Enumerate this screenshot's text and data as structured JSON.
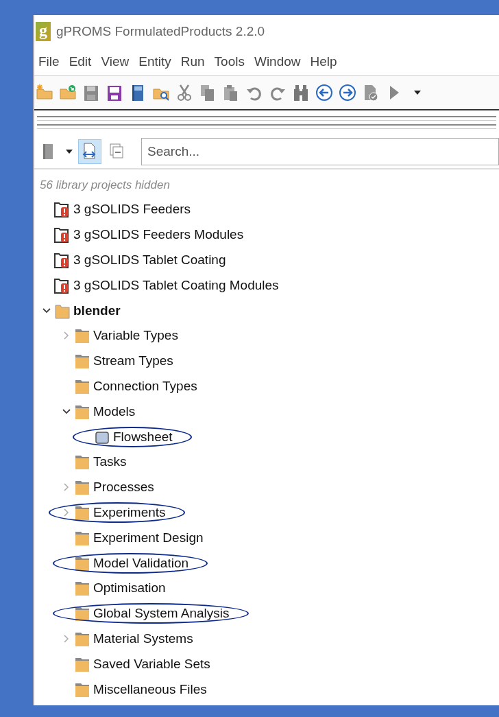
{
  "window": {
    "logo": "g",
    "title": "gPROMS FormulatedProducts 2.2.0"
  },
  "menu": [
    "File",
    "Edit",
    "View",
    "Entity",
    "Run",
    "Tools",
    "Window",
    "Help"
  ],
  "view_toolbar": [
    {
      "kind": "dropdown",
      "selected": false
    },
    {
      "kind": "toggle",
      "selected": true
    },
    {
      "kind": "button",
      "selected": false
    }
  ],
  "search": {
    "placeholder": "Search..."
  },
  "tree_hint": "56 library projects hidden",
  "tree": [
    {
      "kind": "library-project",
      "label": "3 gSOLIDS Feeders",
      "highlighted": false
    },
    {
      "kind": "library-project",
      "label": "3 gSOLIDS Feeders Modules",
      "highlighted": false
    },
    {
      "kind": "library-project",
      "label": "3 gSOLIDS Tablet Coating",
      "highlighted": false
    },
    {
      "kind": "library-project",
      "label": "3 gSOLIDS Tablet Coating Modules",
      "highlighted": false
    },
    {
      "kind": "project",
      "label": "blender",
      "expanded": true,
      "highlighted": false,
      "children": [
        {
          "kind": "folder",
          "label": "Variable Types",
          "expanded": false,
          "highlighted": false
        },
        {
          "kind": "folder",
          "label": "Stream Types",
          "highlighted": false
        },
        {
          "kind": "folder",
          "label": "Connection Types",
          "highlighted": false
        },
        {
          "kind": "folder",
          "label": "Models",
          "expanded": true,
          "highlighted": false,
          "children": [
            {
              "kind": "model",
              "label": "Flowsheet",
              "highlighted": true
            }
          ]
        },
        {
          "kind": "folder",
          "label": "Tasks",
          "highlighted": false
        },
        {
          "kind": "folder",
          "label": "Processes",
          "expanded": false,
          "highlighted": false
        },
        {
          "kind": "folder",
          "label": "Experiments",
          "expanded": false,
          "highlighted": true
        },
        {
          "kind": "folder",
          "label": "Experiment Design",
          "highlighted": false
        },
        {
          "kind": "folder",
          "label": "Model Validation",
          "highlighted": true
        },
        {
          "kind": "folder",
          "label": "Optimisation",
          "highlighted": false
        },
        {
          "kind": "folder",
          "label": "Global System Analysis",
          "highlighted": true
        },
        {
          "kind": "folder",
          "label": "Material Systems",
          "expanded": false,
          "highlighted": false
        },
        {
          "kind": "folder",
          "label": "Saved Variable Sets",
          "highlighted": false
        },
        {
          "kind": "folder",
          "label": "Miscellaneous Files",
          "highlighted": false
        }
      ]
    }
  ]
}
